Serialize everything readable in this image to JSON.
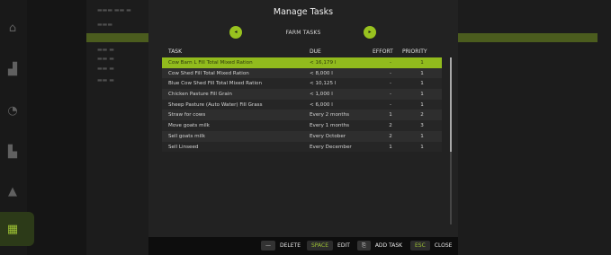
{
  "modal": {
    "title": "Manage Tasks",
    "tab_label": "FARM TASKS",
    "tab_prev_icon": "◂",
    "tab_next_icon": "▸"
  },
  "table": {
    "headers": [
      "TASK",
      "DUE",
      "EFFORT",
      "PRIORITY"
    ],
    "rows": [
      {
        "task": "Cow Barn L Fill Total Mixed Ration",
        "due": "< 16,179 l",
        "effort": "-",
        "priority": "1"
      },
      {
        "task": "Cow Shed Fill Total Mixed Ration",
        "due": "< 8,000 l",
        "effort": "-",
        "priority": "1"
      },
      {
        "task": "Blue Cow Shed Fill Total Mixed Ration",
        "due": "< 10,125 l",
        "effort": "-",
        "priority": "1"
      },
      {
        "task": "Chicken Pasture Fill Grain",
        "due": "< 1,000 l",
        "effort": "-",
        "priority": "1"
      },
      {
        "task": "Sheep Pasture (Auto Water) Fill Grass",
        "due": "< 6,000 l",
        "effort": "-",
        "priority": "1"
      },
      {
        "task": "Straw for cows",
        "due": "Every 2 months",
        "effort": "1",
        "priority": "2"
      },
      {
        "task": "Move goats milk",
        "due": "Every 1 months",
        "effort": "2",
        "priority": "3"
      },
      {
        "task": "Sell goats milk",
        "due": "Every October",
        "effort": "2",
        "priority": "1"
      },
      {
        "task": "Sell Linseed",
        "due": "Every December",
        "effort": "1",
        "priority": "1"
      }
    ],
    "selected_index": 0
  },
  "footer": {
    "delete": {
      "key": "—",
      "label": "DELETE"
    },
    "edit": {
      "key": "SPACE",
      "label": "EDIT"
    },
    "add": {
      "key": "⎘",
      "label": "ADD TASK"
    },
    "close": {
      "key": "ESC",
      "label": "CLOSE"
    }
  },
  "sidebar_icons": [
    "animals-icon",
    "production-icon",
    "finances-icon",
    "statistics-icon",
    "workers-icon",
    "tasks-icon"
  ],
  "colors": {
    "accent": "#98c21f",
    "modal_bg": "#222222",
    "selected_row": "#91bb1d"
  }
}
